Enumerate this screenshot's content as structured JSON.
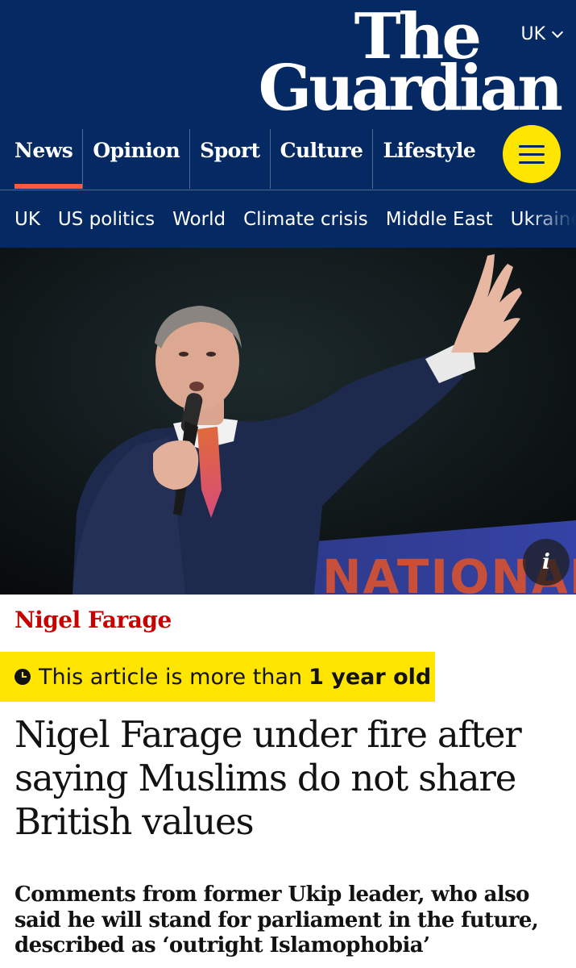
{
  "header": {
    "edition": "UK",
    "logo_line1": "The",
    "logo_line2": "Guardian",
    "pillars": [
      {
        "label": "News",
        "active": true
      },
      {
        "label": "Opinion",
        "active": false
      },
      {
        "label": "Sport",
        "active": false
      },
      {
        "label": "Culture",
        "active": false
      },
      {
        "label": "Lifestyle",
        "active": false
      }
    ],
    "subnav": [
      "UK",
      "US politics",
      "World",
      "Climate crisis",
      "Middle East",
      "Ukraine"
    ]
  },
  "hero": {
    "info_label": "i",
    "banner_text": "NATIONAL"
  },
  "article": {
    "kicker": "Nigel Farage",
    "age_warning_prefix": "This article is more than",
    "age_warning_bold": "1 year old",
    "headline": "Nigel Farage under fire after saying Muslims do not share British values",
    "standfirst": "Comments from former Ukip leader, who also said he will stand for parliament in the future, described as ‘outright Islamophobia’"
  },
  "colors": {
    "brand_blue": "#052962",
    "accent_red": "#c70000",
    "highlight_yellow": "#ffe500",
    "active_underline": "#ff5943"
  },
  "icons": [
    "chevron-down-icon",
    "menu-icon",
    "info-icon",
    "clock-icon"
  ]
}
